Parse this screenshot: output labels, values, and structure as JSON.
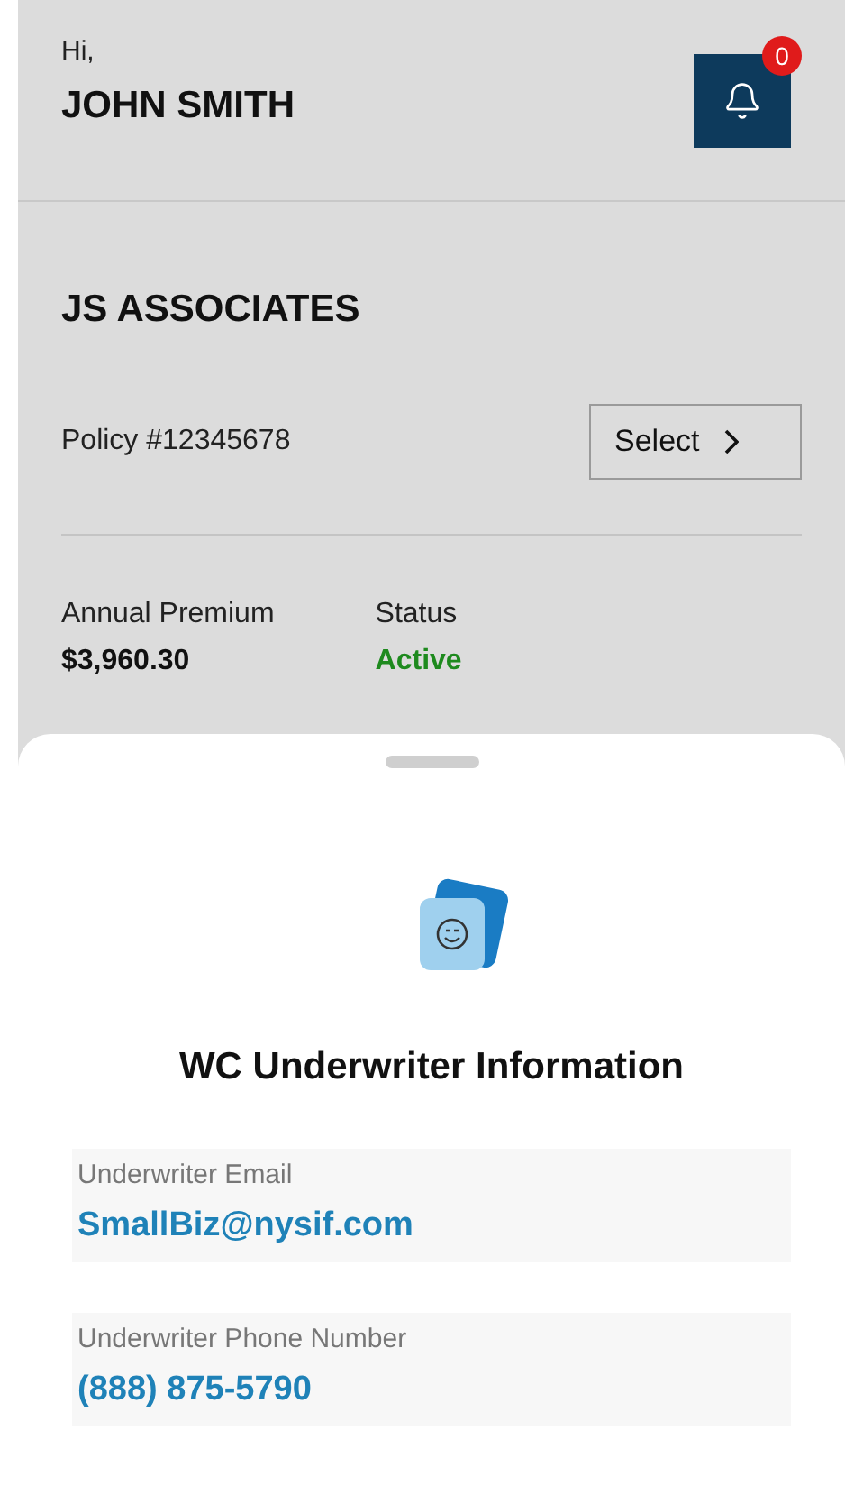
{
  "header": {
    "greeting": "Hi,",
    "name": "JOHN SMITH",
    "notification_count": "0"
  },
  "account": {
    "name": "JS ASSOCIATES",
    "policy": "Policy #12345678",
    "select_button": "Select",
    "premium": {
      "label": "Annual Premium",
      "value": "$3,960.30"
    },
    "status": {
      "label": "Status",
      "value": "Active"
    }
  },
  "sheet": {
    "title": "WC Underwriter Information",
    "fields": [
      {
        "label": "Underwriter Email",
        "value": "SmallBiz@nysif.com"
      },
      {
        "label": "Underwriter Phone Number",
        "value": "(888) 875-5790"
      }
    ]
  }
}
